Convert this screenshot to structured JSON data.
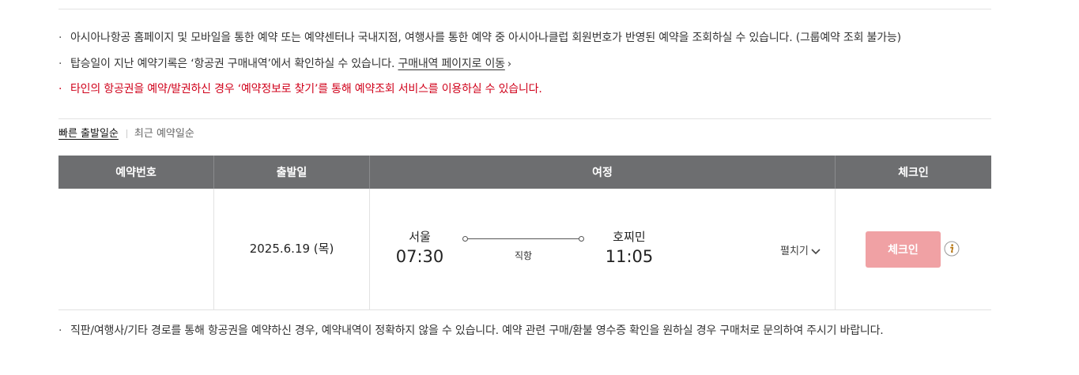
{
  "notices": {
    "bullet": "·",
    "line1": "아시아나항공 홈페이지 및 모바일을 통한 예약 또는 예약센터나 국내지점, 여행사를 통한 예약 중 아시아나클럽 회원번호가 반영된 예약을 조회하실 수 있습니다. (그룹예약 조회 불가능)",
    "line2_text": "탑승일이 지난 예약기록은 ‘항공권 구매내역’에서 확인하실 수 있습니다.",
    "line2_link": "구매내역 페이지로 이동",
    "line3": "타인의 항공권을 예약/발권하신 경우 ‘예약정보로 찾기’를 통해 예약조회 서비스를 이용하실 수 있습니다.",
    "line3_color": "#d0021b"
  },
  "sort": {
    "active": "빠른 출발일순",
    "inactive": "최근 예약일순"
  },
  "table": {
    "headers": [
      "예약번호",
      "출발일",
      "여정",
      "체크인"
    ],
    "header_bg": "#6d6e70",
    "row": {
      "reservation_number": "",
      "departure_date": "2025.6.19 (목)",
      "departure_city": "서울",
      "departure_time": "07:30",
      "route_type": "직항",
      "arrival_city": "호찌민",
      "arrival_time": "11:05",
      "expand_label": "펼치기",
      "checkin_label": "체크인",
      "checkin_color": "#f0a1a4"
    }
  },
  "bottom_note": "직판/여행사/기타 경로를 통해 항공권을 예약하신 경우, 예약내역이 정확하지 않을 수 있습니다. 예약 관련 구매/환불 영수증 확인을 원하실 경우 구매처로 문의하여 주시기 바랍니다.",
  "icons": {
    "link_chevron": "chevron-right-icon",
    "expand_chevron": "chevron-down-icon",
    "info": "info-icon",
    "info_color": "#b5740f"
  }
}
